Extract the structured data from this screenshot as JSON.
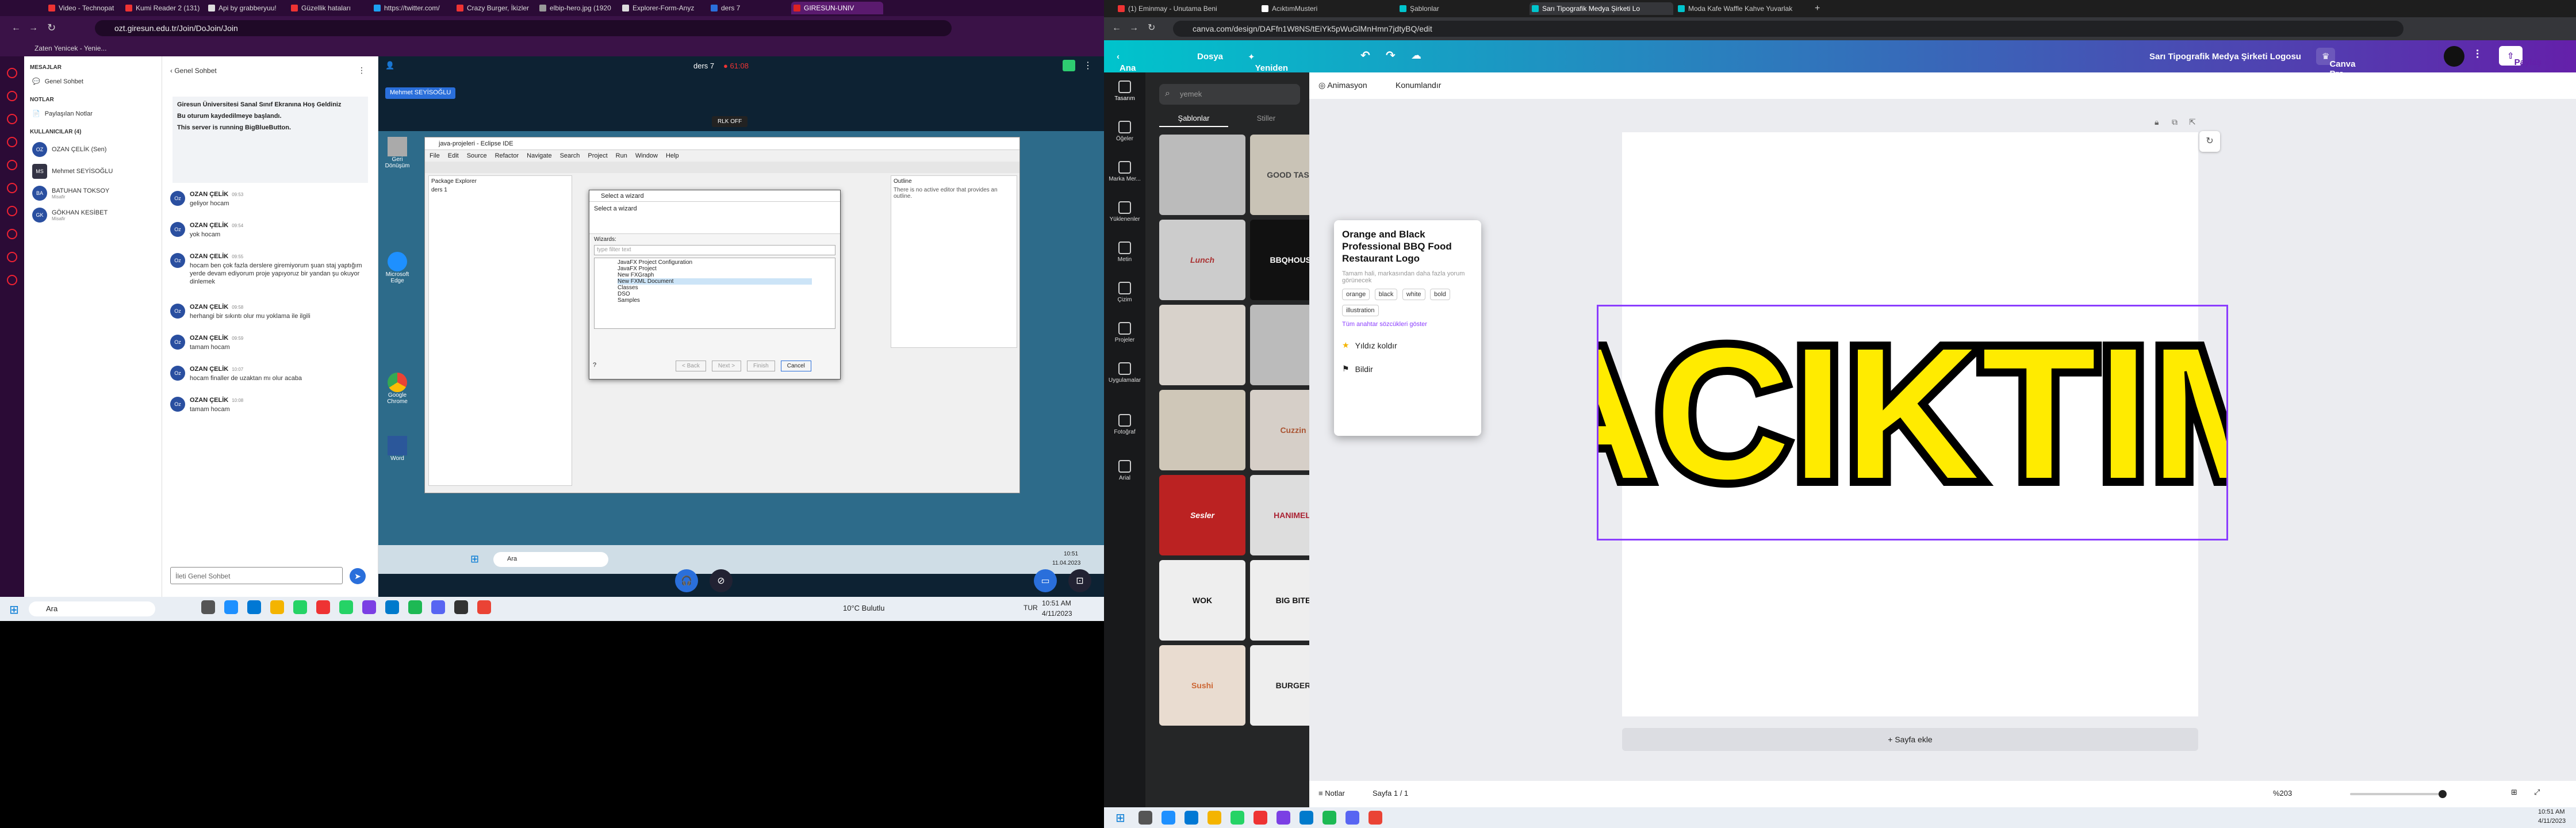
{
  "left": {
    "tabs": [
      "Video - Technopat",
      "Kumi Reader 2 (131)",
      "Api by grabberyuu!",
      "Güzellik hataları",
      "https://twitter.com/",
      "Crazy Burger, İkizler",
      "elbip-hero.jpg (1920",
      "Explorer-Form-Anyz",
      "ders 7",
      "GIRESUN-UNIV"
    ],
    "url": "ozt.giresun.edu.tr/Join/DoJoin/Join",
    "bookmark": "Zaten Yenicek - Yenie...",
    "sidebar": {
      "mesajlar": "MESAJLAR",
      "genel_sohbet": "Genel Sohbet",
      "notlar": "NOTLAR",
      "paylasilan": "Paylaşılan Notlar",
      "kullanicilar": "KULLANICILAR (4)",
      "users": [
        {
          "initials": "OZ",
          "name": "OZAN ÇELİK (Sen)",
          "role": ""
        },
        {
          "initials": "MS",
          "name": "Mehmet SEYİSOĞLU",
          "role": ""
        },
        {
          "initials": "BA",
          "name": "BATUHAN TOKSOY",
          "role": "Misafir"
        },
        {
          "initials": "GK",
          "name": "GÖKHAN KESİBET",
          "role": "Misafir"
        }
      ]
    },
    "chat": {
      "back": "Genel Sohbet",
      "welcome": [
        "Giresun Üniversitesi Sanal Sınıf Ekranına Hoş Geldiniz",
        "Bu oturum kaydedilmeye başlandı.",
        "This server is running BigBlueButton."
      ],
      "messages": [
        {
          "name": "OZAN ÇELİK",
          "time": "09:53",
          "text": "geliyor hocam"
        },
        {
          "name": "OZAN ÇELİK",
          "time": "09:54",
          "text": "yok hocam"
        },
        {
          "name": "OZAN ÇELİK",
          "time": "09:55",
          "text": "hocam ben çok fazla derslere giremiyorum şuan staj yaptığım yerde devam ediyorum proje yapıyoruz bir yandan şu okuyor dinlemek"
        },
        {
          "name": "OZAN ÇELİK",
          "time": "09:58",
          "text": "herhangi bir sıkıntı olur mu yoklama ile ilgili"
        },
        {
          "name": "OZAN ÇELİK",
          "time": "09:59",
          "text": "tamam hocam"
        },
        {
          "name": "OZAN ÇELİK",
          "time": "10:07",
          "text": "hocam finaller de uzaktan mı olur acaba"
        },
        {
          "name": "OZAN ÇELİK",
          "time": "10:08",
          "text": "tamam hocam"
        }
      ],
      "input_placeholder": "İleti Genel Sohbet"
    },
    "stage": {
      "title": "ders 7",
      "timer": "61:08",
      "presenter": "Mehmet SEYİSOĞLU",
      "slide_label": "RLK OFF"
    },
    "eclipse": {
      "title": "java-projeleri - Eclipse IDE",
      "menu": [
        "File",
        "Edit",
        "Source",
        "Refactor",
        "Navigate",
        "Search",
        "Project",
        "Run",
        "Window",
        "Help"
      ],
      "package_explorer": "Package Explorer",
      "project": "ders 1",
      "outline": "Outline",
      "outline_text": "There is no active editor that provides an outline."
    },
    "dialog": {
      "title": "Select a wizard",
      "subtitle": "Select a wizard",
      "wizards": "Wizards:",
      "filter": "type filter text",
      "items": [
        "JavaFX Project Configuration",
        "JavaFX Project",
        "New FXGraph",
        "New FXML Document",
        "Classes",
        "DSO",
        "Samples"
      ],
      "buttons": [
        "< Back",
        "Next >",
        "Finish",
        "Cancel"
      ]
    },
    "win": {
      "search": "Ara",
      "time": "10:51",
      "date": "11.04.2023"
    },
    "desktop_icons": [
      "Geri Dönüşüm",
      "Microsoft Edge",
      "Google Chrome",
      "Word"
    ],
    "taskbar": {
      "search": "Ara",
      "weather": "10°C",
      "weather_desc": "Bulutlu",
      "lang": "TUR",
      "time": "10:51 AM",
      "date": "4/11/2023"
    }
  },
  "right": {
    "tabs": [
      "(1) Eminmay - Unutama Beni",
      "AcıktımMusteri",
      "Şablonlar",
      "Sarı Tipografik Medya Şirketi Lo",
      "Moda Kafe Waffle Kahve Yuvarlak"
    ],
    "url": "canva.com/design/DAFfn1W8NS/tEiYk5pWuGlMnHmn7jdtyBQ/edit",
    "top": {
      "home": "Ana Sayfa",
      "file": "Dosya",
      "resize": "Yeniden boyutlandır",
      "title": "Sarı Tipografik Medya Şirketi Logosu",
      "pro": "Canva Pro planını deneyin",
      "share": "Paylaş"
    },
    "rail": [
      "Tasarım",
      "Öğeler",
      "Marka Mer...",
      "Yüklenenler",
      "Metin",
      "Çizim",
      "Projeler",
      "Uygulamalar",
      "Fotoğraf",
      "Arial"
    ],
    "panel": {
      "search": "yemek",
      "tab1": "Şablonlar",
      "tab2": "Stiller",
      "tiles": [
        "",
        "GOOD TASTE",
        "Lunch",
        "BBQHOUSE",
        "",
        "",
        "",
        "",
        "",
        "Cuzzin",
        "Sesler",
        "HANIMELI",
        "WOK",
        "BIG BITE",
        "Sushi",
        "BURGER"
      ]
    },
    "popup": {
      "title": "Orange and Black Professional BBQ Food Restaurant Logo",
      "desc": "Tamam hali, markasından daha fazla yorum görünecek",
      "tags": [
        "orange",
        "black",
        "white",
        "bold",
        "illustration"
      ],
      "more": "Tüm anahtar sözcükleri göster",
      "star": "Yıldız koldır",
      "report": "Bildir"
    },
    "subbar": {
      "anim": "Animasyon",
      "pos": "Konumlandır"
    },
    "logo_text": "ACIKTIM",
    "add_page": "+ Sayfa ekle",
    "bottom": {
      "notes": "Notlar",
      "page": "Sayfa 1 / 1",
      "zoom": "%203"
    },
    "taskbar": {
      "time": "10:51 AM",
      "date": "4/11/2023"
    }
  },
  "colors": {
    "canva_purple": "#8b3dff",
    "logo_yellow": "#ffeb00",
    "bbb_blue": "#0d2233"
  }
}
